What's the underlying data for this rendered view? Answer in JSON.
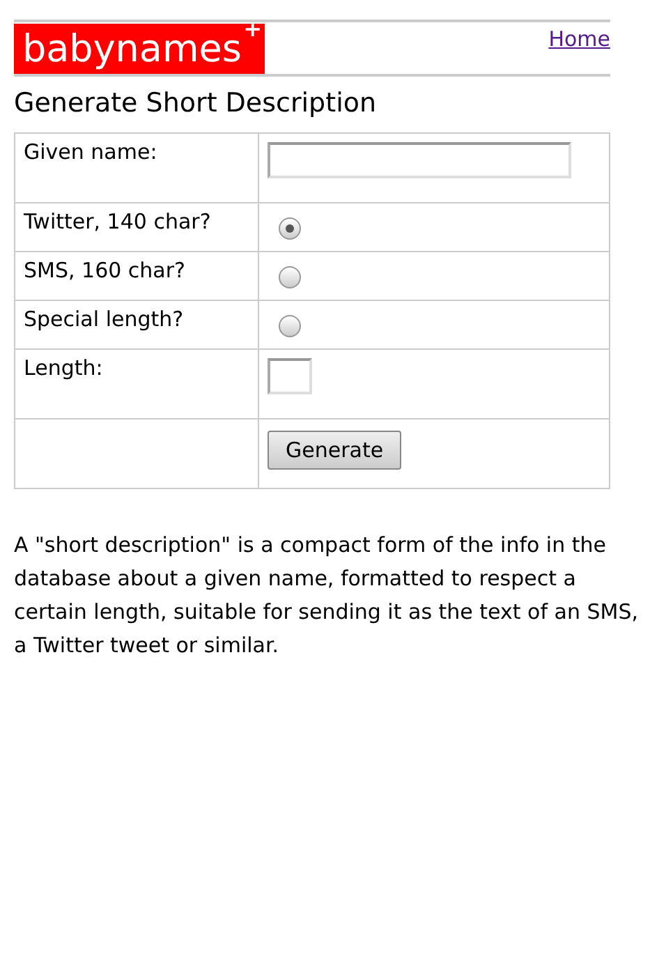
{
  "header": {
    "logo": "babynames",
    "logo_mark": "+",
    "nav_link": "Home"
  },
  "title": "Generate Short Description",
  "form": {
    "rows": [
      {
        "kind": "text",
        "label": "Given name:",
        "value": ""
      },
      {
        "kind": "radio",
        "label": "Twitter, 140 char?",
        "selected": true
      },
      {
        "kind": "radio",
        "label": "SMS, 160 char?",
        "selected": false
      },
      {
        "kind": "radio",
        "label": "Special length?",
        "selected": false
      },
      {
        "kind": "short-text",
        "label": "Length:",
        "value": ""
      },
      {
        "kind": "button",
        "label": "Generate"
      }
    ]
  },
  "description": "A \"short description\" is a compact form of the info in the database about a given name, formatted to respect a certain length, suitable for sending it as the text of an SMS, a Twitter tweet or similar."
}
